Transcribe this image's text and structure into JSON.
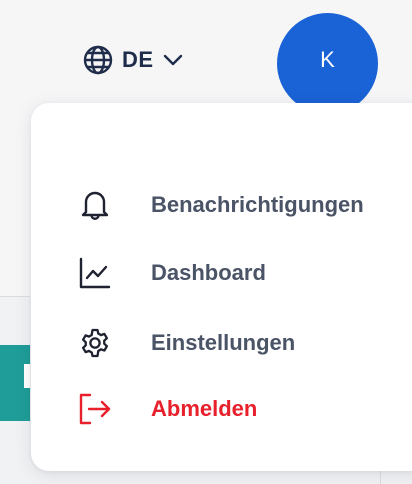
{
  "header": {
    "language": {
      "icon": "globe-icon",
      "label": "DE",
      "caret_icon": "chevron-down-icon"
    },
    "avatar": {
      "initial": "K",
      "color": "#1a63d6"
    }
  },
  "menu": {
    "items": [
      {
        "icon": "bell-icon",
        "label": "Benachrichtigungen"
      },
      {
        "icon": "chart-line-icon",
        "label": "Dashboard"
      },
      {
        "icon": "gear-icon",
        "label": "Einstellungen"
      },
      {
        "icon": "logout-icon",
        "label": "Abmelden",
        "color": "#e8202c"
      }
    ]
  }
}
